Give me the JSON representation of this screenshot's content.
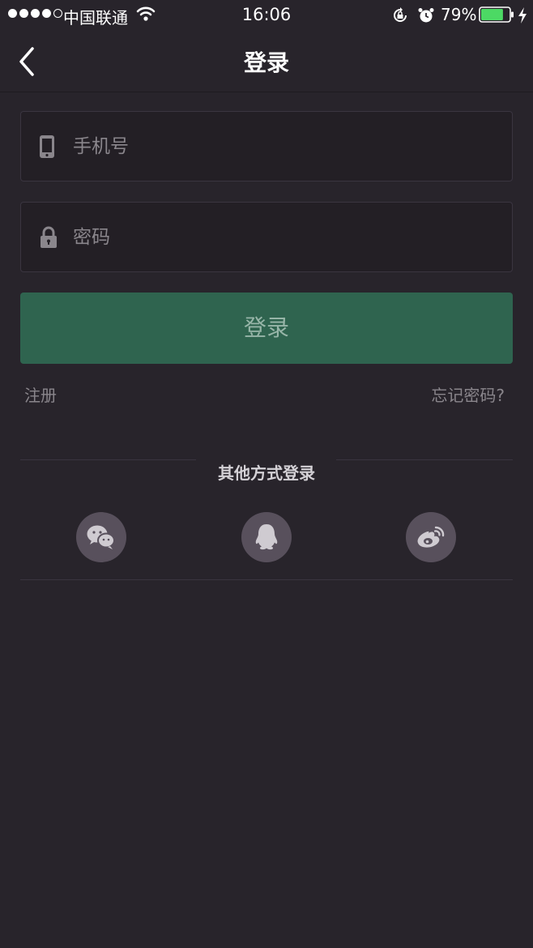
{
  "status_bar": {
    "carrier": "中国联通",
    "time": "16:06",
    "battery_percent": "79%",
    "battery_level": 0.79,
    "signal_strength": 4,
    "signal_max": 5
  },
  "nav": {
    "title": "登录",
    "back_icon": "chevron-left-icon"
  },
  "form": {
    "phone": {
      "placeholder": "手机号",
      "value": "",
      "icon": "phone-icon"
    },
    "password": {
      "placeholder": "密码",
      "value": "",
      "icon": "lock-icon"
    },
    "submit_label": "登录",
    "submit_color": "#2f644f"
  },
  "links": {
    "register": "注册",
    "forgot_password": "忘记密码?"
  },
  "other_login": {
    "title": "其他方式登录",
    "providers": [
      {
        "name": "wechat",
        "icon": "wechat-icon"
      },
      {
        "name": "qq",
        "icon": "qq-icon"
      },
      {
        "name": "weibo",
        "icon": "weibo-icon"
      }
    ]
  },
  "colors": {
    "background": "#28242b",
    "accent_green": "#2f644f",
    "battery_green": "#4cd964",
    "social_circle": "#58505c"
  }
}
